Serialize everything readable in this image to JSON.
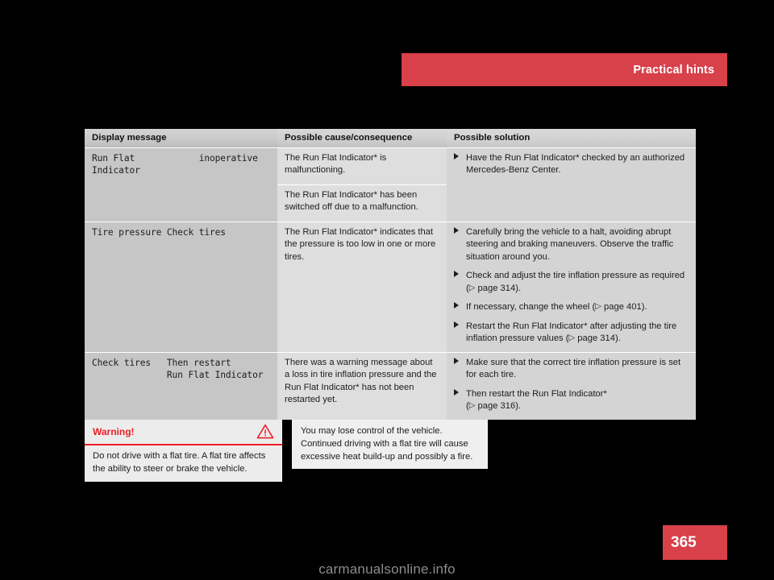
{
  "header": {
    "title": "Practical hints"
  },
  "table": {
    "columns": [
      "Display message",
      "Possible cause/consequence",
      "Possible solution"
    ],
    "rows": [
      {
        "message_lines": [
          "Run Flat            inoperative",
          "Indicator"
        ],
        "causes": [
          "The Run Flat Indicator* is malfunctioning.",
          "The Run Flat Indicator* has been switched off due to a malfunction."
        ],
        "solutions": [
          {
            "text": "Have the Run Flat Indicator* checked by an authorized Mercedes-Benz Center."
          }
        ]
      },
      {
        "message_lines": [
          "Tire pressure Check tires"
        ],
        "alert": true,
        "causes": [
          "The Run Flat Indicator* indicates that the pressure is too low in one or more tires."
        ],
        "solutions": [
          {
            "text": "Carefully bring the vehicle to a halt, avoiding abrupt steering and braking maneuvers. Observe the traffic situation around you."
          },
          {
            "text": "Check and adjust the tire inflation pressure as required (",
            "ref": "page 314",
            "after": ")."
          },
          {
            "text": "If necessary, change the wheel (",
            "ref": "page 401",
            "after": ")."
          },
          {
            "text": "Restart the Run Flat Indicator* after adjusting the tire inflation pressure values (",
            "ref": "page 314",
            "after": ")."
          }
        ]
      },
      {
        "message_lines": [
          "Check tires   Then restart",
          "              Run Flat Indicator"
        ],
        "causes": [
          "There was a warning message about a loss in tire inflation pressure and the Run Flat Indicator* has not been restarted yet."
        ],
        "solutions": [
          {
            "text": "Make sure that the correct tire inflation pressure is set for each tire."
          },
          {
            "text": "Then restart the Run Flat Indicator*\n(",
            "ref": "page 316",
            "after": ")."
          }
        ]
      }
    ]
  },
  "warning": {
    "title": "Warning!",
    "icon": "warning-triangle-icon",
    "body": "Do not drive with a flat tire. A flat tire affects the ability to steer or brake the vehicle."
  },
  "note": {
    "body": "You may lose control of the vehicle. Continued driving with a flat tire will cause excessive heat build-up and possibly a fire."
  },
  "footer": {
    "page_number": "365",
    "watermark": "carmanualsonline.info"
  },
  "colors": {
    "brand_red": "#d8404a",
    "warning_red": "#ee1c25",
    "alert_message": "#ee6f73",
    "message_gray": "#8e8e8e"
  }
}
